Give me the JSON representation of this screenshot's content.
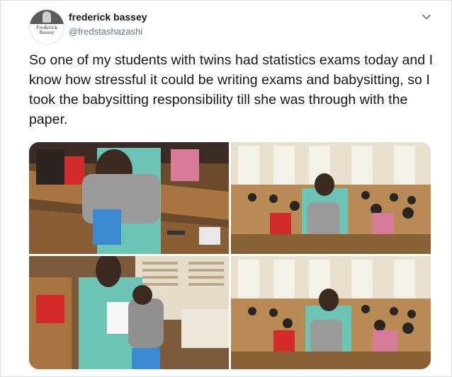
{
  "tweet": {
    "avatar_text": "Frederick Bassey",
    "display_name": "frederick bassey",
    "handle": "@fredstashazashi",
    "text": "So one of my students with twins had statistics exams today and I know how stressful it could be writing exams and babysitting, so I took the babysitting responsibility till she was through with the paper."
  },
  "photos": [
    {
      "name": "photo-man-holding-baby-closeup"
    },
    {
      "name": "photo-man-carrying-baby-exam-hall"
    },
    {
      "name": "photo-man-holding-baby-window"
    },
    {
      "name": "photo-man-carrying-baby-students-writing"
    }
  ],
  "icons": {
    "menu": "chevron-down-icon"
  }
}
